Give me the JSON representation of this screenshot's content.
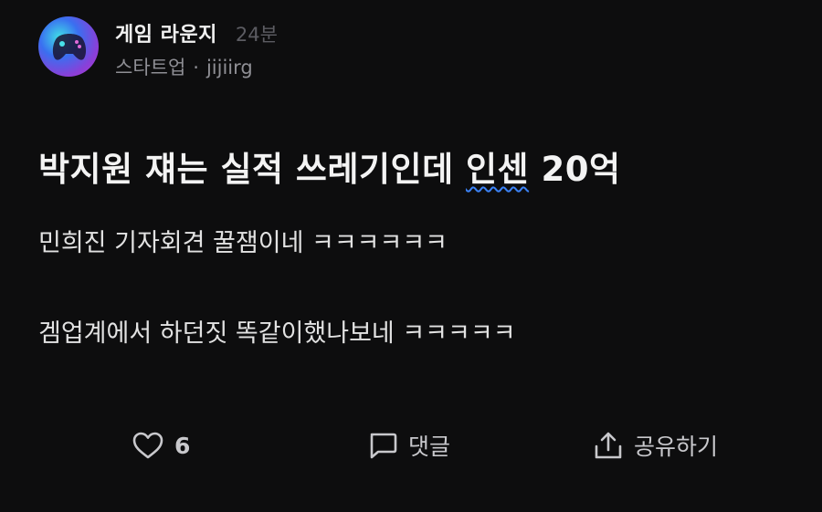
{
  "header": {
    "lounge_name": "게임 라운지",
    "time": "24분",
    "company": "스타트업",
    "separator": "·",
    "author": "jijiirg"
  },
  "post": {
    "title_main": "박지원 쟤는 실적 쓰레기인데 ",
    "title_spell": "인센",
    "title_end": " 20억",
    "lines": [
      "민희진 기자회견 꿀잼이네 ㅋㅋㅋㅋㅋㅋ",
      "겜업계에서 하던짓 똑같이했나보네 ㅋㅋㅋㅋㅋ"
    ]
  },
  "actions": {
    "like_count": "6",
    "comment_label": "댓글",
    "share_label": "공유하기"
  },
  "icons": {
    "avatar": "gamepad-icon",
    "like": "heart-icon",
    "comment": "comment-icon",
    "share": "share-icon"
  },
  "colors": {
    "background": "#0d0d0e",
    "spellcheck_underline": "#3b82f6"
  }
}
